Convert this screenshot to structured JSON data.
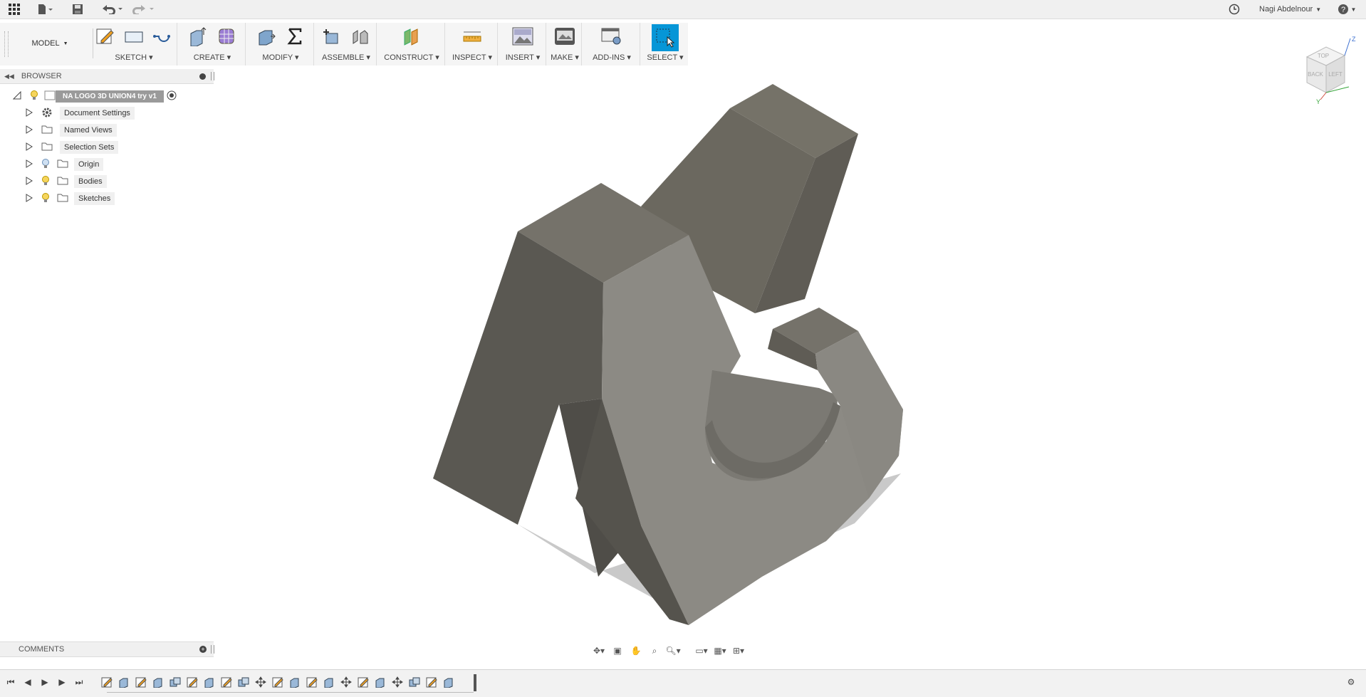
{
  "topbar": {
    "user_name": "Nagi Abdelnour",
    "icons": [
      "apps-grid-icon",
      "file-icon",
      "save-icon",
      "undo-icon",
      "redo-icon",
      "job-status-icon",
      "help-icon"
    ]
  },
  "toolbar": {
    "workspace_label": "MODEL",
    "groups": [
      {
        "label": "SKETCH"
      },
      {
        "label": "CREATE"
      },
      {
        "label": "MODIFY"
      },
      {
        "label": "ASSEMBLE"
      },
      {
        "label": "CONSTRUCT"
      },
      {
        "label": "INSPECT"
      },
      {
        "label": "INSERT"
      },
      {
        "label": "MAKE"
      },
      {
        "label": "ADD-INS"
      },
      {
        "label": "SELECT"
      }
    ]
  },
  "browser": {
    "title": "BROWSER",
    "root": "NA LOGO 3D UNION4 try v1",
    "items": [
      {
        "label": "Document Settings",
        "icon": "gear-icon"
      },
      {
        "label": "Named Views",
        "icon": "folder-icon"
      },
      {
        "label": "Selection Sets",
        "icon": "folder-icon"
      },
      {
        "label": "Origin",
        "icon": "folder-icon"
      },
      {
        "label": "Bodies",
        "icon": "folder-icon"
      },
      {
        "label": "Sketches",
        "icon": "folder-icon"
      }
    ]
  },
  "comments": {
    "title": "COMMENTS"
  },
  "viewcube": {
    "faces": [
      "TOP",
      "BACK",
      "LEFT"
    ],
    "axes": [
      "Z",
      "Y"
    ]
  },
  "colors": {
    "accent": "#0696d7",
    "body_light": "#8c8a84",
    "body_dark": "#5d5b55",
    "body_top": "#75726a"
  }
}
